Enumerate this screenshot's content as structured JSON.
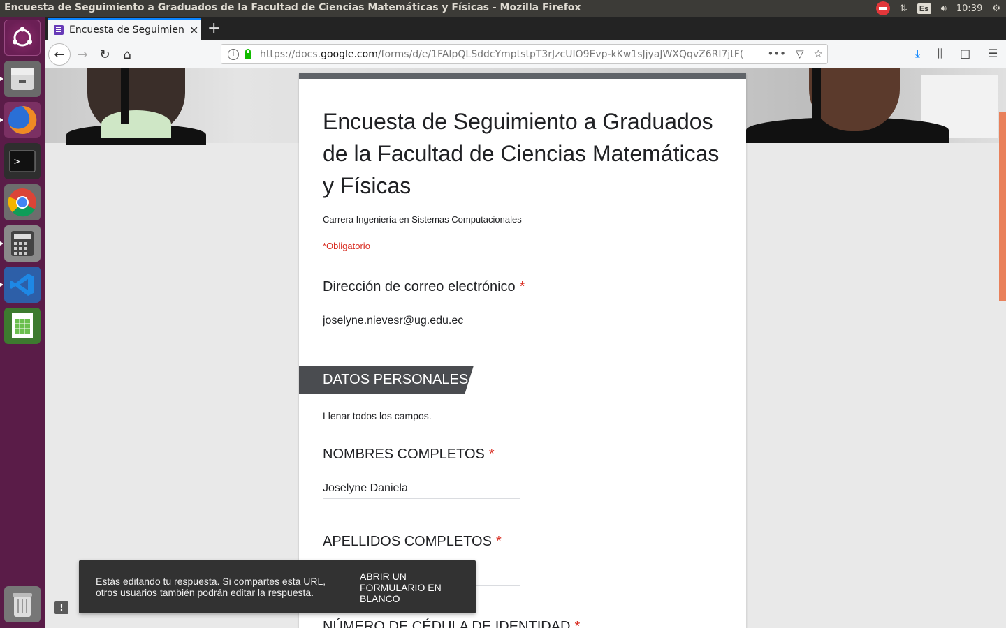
{
  "system": {
    "window_title": "Encuesta de Seguimiento a Graduados de la Facultad de Ciencias Matemáticas y Físicas - Mozilla Firefox",
    "keyboard_layout": "Es",
    "clock": "10:39"
  },
  "launcher": {
    "items": [
      "ubuntu-dash",
      "files",
      "firefox",
      "terminal",
      "chrome",
      "calculator",
      "vscode",
      "spreadsheet",
      "trash"
    ]
  },
  "browser": {
    "tab_title": "Encuesta de Seguimiento",
    "tab_close": "✕",
    "new_tab": "+",
    "url_domain_prefix": "https://docs.",
    "url_domain": "google.com",
    "url_path": "/forms/d/e/1FAIpQLSddcYmptstpT3rJzcUIO9Evp-kKw1sJjyaJWXQqvZ6RI7jtF(",
    "url_more": "•••"
  },
  "form": {
    "title": "Encuesta de Seguimiento a Graduados de la Facultad de Ciencias Matemáticas y Físicas",
    "description": "Carrera Ingeniería en Sistemas Computacionales",
    "required_note": "*Obligatorio",
    "email_label": "Dirección de correo electrónico",
    "email_value": "joselyne.nievesr@ug.edu.ec",
    "section_title": "DATOS PERSONALES",
    "section_desc": "Llenar todos los campos.",
    "names_label": "NOMBRES COMPLETOS",
    "names_value": "Joselyne Daniela",
    "surnames_label": "APELLIDOS COMPLETOS",
    "surnames_value": "",
    "id_label": "NÚMERO DE CÉDULA DE IDENTIDAD",
    "required_star": "*"
  },
  "snackbar": {
    "message": "Estás editando tu respuesta. Si compartes esta URL, otros usuarios también podrán editar la respuesta.",
    "action": "ABRIR UN FORMULARIO EN BLANCO"
  },
  "feedback_icon": "!"
}
